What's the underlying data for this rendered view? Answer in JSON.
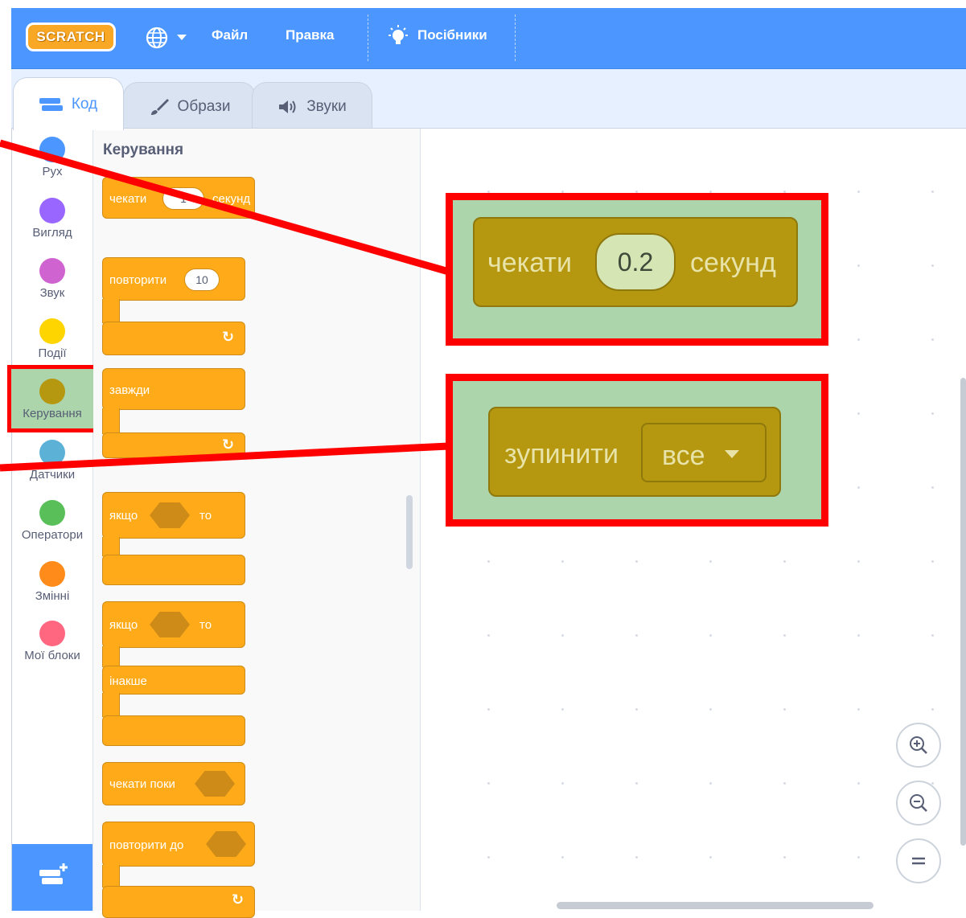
{
  "menubar": {
    "logo_text": "SCRATCH",
    "file_label": "Файл",
    "edit_label": "Правка",
    "tutorials_label": "Посібники"
  },
  "tabs": {
    "code_label": "Код",
    "costumes_label": "Образи",
    "sounds_label": "Звуки"
  },
  "categories": [
    {
      "label": "Рух",
      "color": "#4c97ff"
    },
    {
      "label": "Вигляд",
      "color": "#9966ff"
    },
    {
      "label": "Звук",
      "color": "#cf63cf"
    },
    {
      "label": "Події",
      "color": "#ffd500"
    },
    {
      "label": "Керування",
      "color": "#b59810",
      "selected": true
    },
    {
      "label": "Датчики",
      "color": "#5cb1d6"
    },
    {
      "label": "Оператори",
      "color": "#59c059"
    },
    {
      "label": "Змінні",
      "color": "#ff8c1a"
    },
    {
      "label": "Мої блоки",
      "color": "#ff6680"
    }
  ],
  "palette": {
    "title": "Керування",
    "wait_label": "чекати",
    "wait_value": "1",
    "wait_unit": "секунд",
    "repeat_label": "повторити",
    "repeat_value": "10",
    "forever_label": "завжди",
    "if_label": "якщо",
    "then_label": "то",
    "if2_label": "якщо",
    "then2_label": "то",
    "else_label": "інакше",
    "wait_until_label": "чекати поки",
    "repeat_until_label": "повторити до"
  },
  "workspace": {
    "wait_block": {
      "label": "чекати",
      "value": "0.2",
      "unit": "секунд"
    },
    "stop_block": {
      "label": "зупинити",
      "option": "все"
    }
  },
  "colors": {
    "menubar": "#4c97ff",
    "control_block": "#ffab19",
    "highlight_border": "#ff0000",
    "highlight_fill": "#acd5ac",
    "big_block": "#b59810"
  }
}
